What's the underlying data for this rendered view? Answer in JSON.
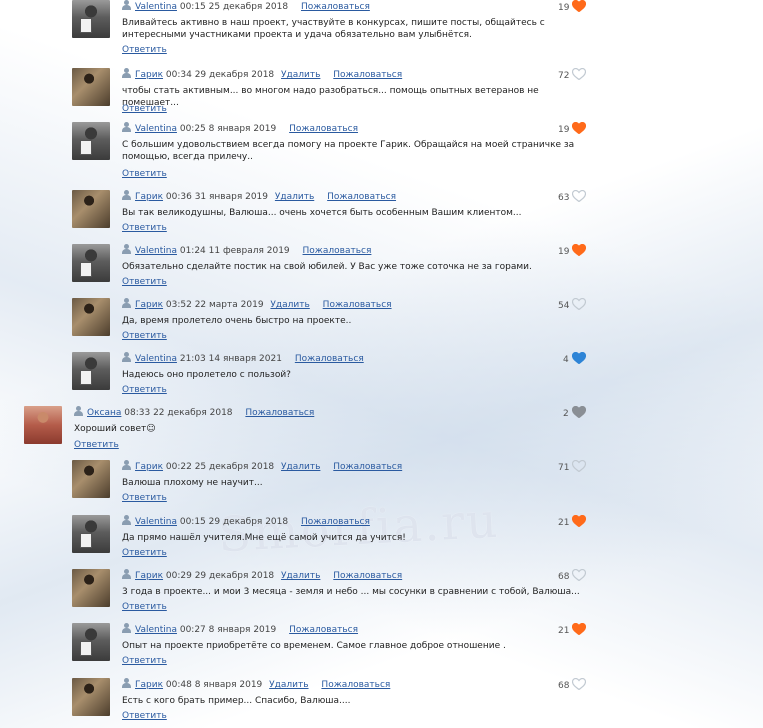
{
  "labels": {
    "reply": "Ответить",
    "delete": "Удалить",
    "report": "Пожаловаться"
  },
  "colors": {
    "link": "#2a5aa0",
    "heart_orange": "#ff6a1a",
    "heart_blue": "#2e84d6",
    "heart_gray": "#c2cad2"
  },
  "watermark": "Smorfia.ru",
  "comments": [
    {
      "author": "Valentina",
      "datetime": "00:15 25 декабря 2018",
      "text": "Вливайтесь активно в наш проект, участвуйте в конкурсах, пишите посты, общайтесь с интересными участниками проекта и удача обязательно вам улыбнётся.",
      "likes": "19",
      "heart": "orange",
      "has_delete": false,
      "avatar": "valentina"
    },
    {
      "author": "Гарик",
      "datetime": "00:34 29 декабря 2018",
      "text": "чтобы стать активным... во многом надо разобраться... помощь опытных ветеранов не помешает...",
      "likes": "72",
      "heart": "gray",
      "has_delete": true,
      "avatar": "garik"
    },
    {
      "author": "Valentina",
      "datetime": "00:25 8 января 2019",
      "text": "С большим удовольствием всегда помогу на проекте Гарик. Обращайся на моей страничке за помощью, всегда прилечу..",
      "likes": "19",
      "heart": "orange",
      "has_delete": false,
      "avatar": "valentina"
    },
    {
      "author": "Гарик",
      "datetime": "00:36 31 января 2019",
      "text": "Вы так великодушны, Валюша... очень хочется быть особенным Вашим клиентом...",
      "likes": "63",
      "heart": "gray",
      "has_delete": true,
      "avatar": "garik"
    },
    {
      "author": "Valentina",
      "datetime": "01:24 11 февраля 2019",
      "text": "Обязательно сделайте постик на свой юбилей. У Вас уже тоже соточка не за горами.",
      "likes": "19",
      "heart": "orange",
      "has_delete": false,
      "avatar": "valentina"
    },
    {
      "author": "Гарик",
      "datetime": "03:52 22 марта 2019",
      "text": "Да, время пролетело очень быстро на проекте..",
      "likes": "54",
      "heart": "gray",
      "has_delete": true,
      "avatar": "garik"
    },
    {
      "author": "Valentina",
      "datetime": "21:03 14 января 2021",
      "text": "Надеюсь оно пролетело с пользой?",
      "likes": "4",
      "heart": "blue",
      "has_delete": false,
      "avatar": "valentina"
    },
    {
      "author": "Оксана",
      "datetime": "08:33 22 декабря 2018",
      "text": "Хороший совет☺",
      "likes": "2",
      "heart": "darkgray",
      "has_delete": false,
      "avatar": "oksana"
    },
    {
      "author": "Гарик",
      "datetime": "00:22 25 декабря 2018",
      "text": "Валюша плохому не научит...",
      "likes": "71",
      "heart": "gray",
      "has_delete": true,
      "avatar": "garik"
    },
    {
      "author": "Valentina",
      "datetime": "00:15 29 декабря 2018",
      "text": "Да прямо нашёл учителя.Мне ещё самой учится да учится!",
      "likes": "21",
      "heart": "orange",
      "has_delete": false,
      "avatar": "valentina"
    },
    {
      "author": "Гарик",
      "datetime": "00:29 29 декабря 2018",
      "text": "3 года в проекте... и мои 3 месяца - земля и небо ... мы сосунки в сравнении с тобой, Валюша...",
      "likes": "68",
      "heart": "gray",
      "has_delete": true,
      "avatar": "garik"
    },
    {
      "author": "Valentina",
      "datetime": "00:27 8 января 2019",
      "text": "Опыт на проекте приобретёте со временем. Самое главное доброе отношение .",
      "likes": "21",
      "heart": "orange",
      "has_delete": false,
      "avatar": "valentina"
    },
    {
      "author": "Гарик",
      "datetime": "00:48 8 января 2019",
      "text": "Есть с кого брать пример... Спасибо, Валюша....",
      "likes": "68",
      "heart": "gray",
      "has_delete": true,
      "avatar": "garik"
    }
  ]
}
